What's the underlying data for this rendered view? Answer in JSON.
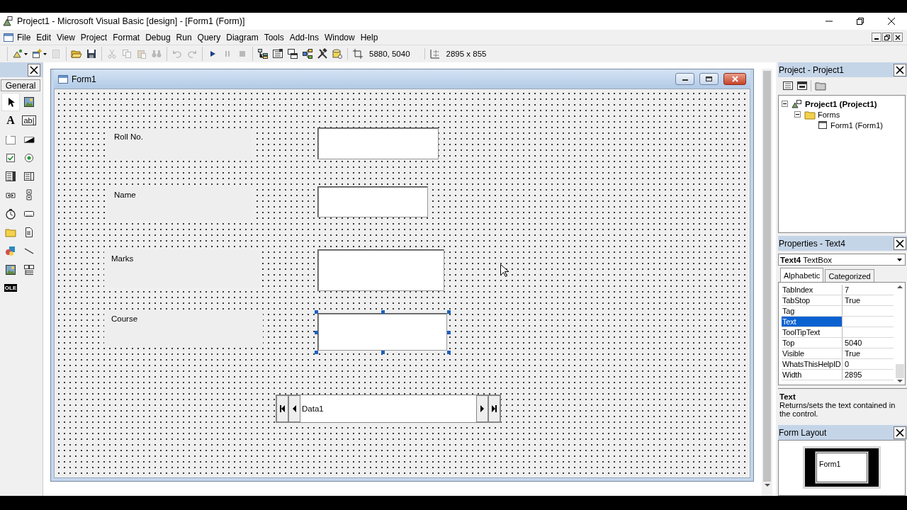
{
  "window": {
    "title": "Project1 - Microsoft Visual Basic [design] - [Form1 (Form)]"
  },
  "menu": [
    "File",
    "Edit",
    "View",
    "Project",
    "Format",
    "Debug",
    "Run",
    "Query",
    "Diagram",
    "Tools",
    "Add-Ins",
    "Window",
    "Help"
  ],
  "toolbar": {
    "groups": [
      [
        {
          "kind": "add-project",
          "disabled": false
        },
        {
          "kind": "add-form",
          "disabled": false
        },
        {
          "kind": "menu-editor",
          "disabled": true
        }
      ],
      [
        {
          "kind": "open",
          "disabled": false
        },
        {
          "kind": "save",
          "disabled": false
        }
      ],
      [
        {
          "kind": "cut",
          "disabled": true
        },
        {
          "kind": "copy",
          "disabled": true
        },
        {
          "kind": "paste",
          "disabled": true
        },
        {
          "kind": "find",
          "disabled": true
        }
      ],
      [
        {
          "kind": "undo",
          "disabled": true
        },
        {
          "kind": "redo",
          "disabled": true
        }
      ],
      [
        {
          "kind": "start",
          "disabled": false
        },
        {
          "kind": "pause",
          "disabled": true
        },
        {
          "kind": "stop",
          "disabled": true
        }
      ],
      [
        {
          "kind": "project",
          "disabled": false
        },
        {
          "kind": "properties",
          "disabled": false
        },
        {
          "kind": "layout",
          "disabled": false
        },
        {
          "kind": "browser",
          "disabled": false
        },
        {
          "kind": "toolbox",
          "disabled": false
        },
        {
          "kind": "dataview",
          "disabled": false
        }
      ]
    ],
    "position": "5880, 5040",
    "size": "2895 x 855"
  },
  "toolbox": {
    "title": "General",
    "tools": [
      {
        "kind": "pointer",
        "selected": true
      },
      {
        "kind": "picture",
        "selected": false
      },
      {
        "kind": "label",
        "glyph": "A",
        "selected": false
      },
      {
        "kind": "textbox",
        "glyph": "ab|",
        "selected": false
      },
      {
        "kind": "frame",
        "selected": false
      },
      {
        "kind": "command",
        "selected": false
      },
      {
        "kind": "checkbox",
        "selected": false
      },
      {
        "kind": "option",
        "selected": false
      },
      {
        "kind": "combo",
        "selected": false
      },
      {
        "kind": "list",
        "selected": false
      },
      {
        "kind": "hscroll",
        "selected": false
      },
      {
        "kind": "vscroll",
        "selected": false
      },
      {
        "kind": "timer",
        "selected": false
      },
      {
        "kind": "drive",
        "selected": false
      },
      {
        "kind": "folder",
        "selected": false
      },
      {
        "kind": "file",
        "selected": false
      },
      {
        "kind": "shape",
        "selected": false
      },
      {
        "kind": "line",
        "selected": false
      },
      {
        "kind": "image",
        "selected": false
      },
      {
        "kind": "data",
        "selected": false
      },
      {
        "kind": "ole",
        "glyph": "OLE",
        "selected": false
      }
    ]
  },
  "form": {
    "title": "Form1",
    "controls": [
      {
        "kind": "label",
        "caption": "Roll No."
      },
      {
        "kind": "textbox",
        "selected": false
      },
      {
        "kind": "label",
        "caption": "Name"
      },
      {
        "kind": "textbox",
        "selected": false
      },
      {
        "kind": "label",
        "caption": "Marks"
      },
      {
        "kind": "textbox",
        "selected": false
      },
      {
        "kind": "label",
        "caption": "Course"
      },
      {
        "kind": "textbox",
        "selected": true
      },
      {
        "kind": "data",
        "caption": "Data1"
      }
    ]
  },
  "project": {
    "title": "Project - Project1",
    "tree": [
      {
        "label": "Project1 (Project1)",
        "kind": "project",
        "expanded": true,
        "children": [
          {
            "label": "Forms",
            "kind": "folder",
            "expanded": true,
            "children": [
              {
                "label": "Form1 (Form1)",
                "kind": "form"
              }
            ]
          }
        ]
      }
    ]
  },
  "properties": {
    "title": "Properties - Text4",
    "object": "**Text4** TextBox",
    "tabs": [
      {
        "label": "Alphabetic",
        "selected": true
      },
      {
        "label": "Categorized",
        "selected": false
      }
    ],
    "rows": [
      {
        "name": "TabIndex",
        "value": "7",
        "selected": false
      },
      {
        "name": "TabStop",
        "value": "True",
        "selected": false
      },
      {
        "name": "Tag",
        "selected": false
      },
      {
        "name": "Text",
        "selected": true
      },
      {
        "name": "ToolTipText",
        "selected": false
      },
      {
        "name": "Top",
        "value": "5040",
        "selected": false
      },
      {
        "name": "Visible",
        "value": "True",
        "selected": false
      },
      {
        "name": "WhatsThisHelpID",
        "value": "0",
        "selected": false
      },
      {
        "name": "Width",
        "value": "2895",
        "selected": false
      }
    ],
    "description": {
      "title": "Text",
      "text": "Returns/sets the text contained in the control."
    }
  },
  "form_layout": {
    "title": "Form Layout",
    "preview": "Form1"
  }
}
